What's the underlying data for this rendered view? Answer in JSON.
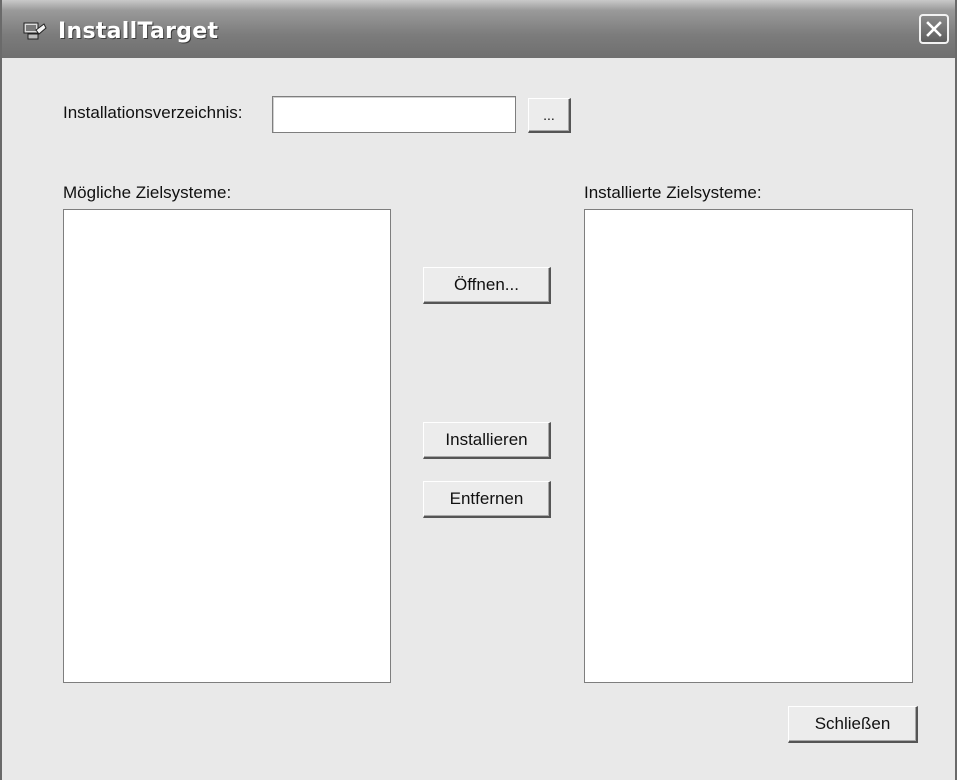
{
  "window": {
    "title": "InstallTarget",
    "icon": "app-icon",
    "close_icon": "close-icon"
  },
  "install_dir": {
    "label": "Installationsverzeichnis:",
    "value": "",
    "browse_label": "..."
  },
  "possible_targets": {
    "label": "Mögliche Zielsysteme:",
    "items": []
  },
  "installed_targets": {
    "label": "Installierte Zielsysteme:",
    "items": []
  },
  "buttons": {
    "open": "Öffnen...",
    "install": "Installieren",
    "remove": "Entfernen",
    "close": "Schließen"
  }
}
